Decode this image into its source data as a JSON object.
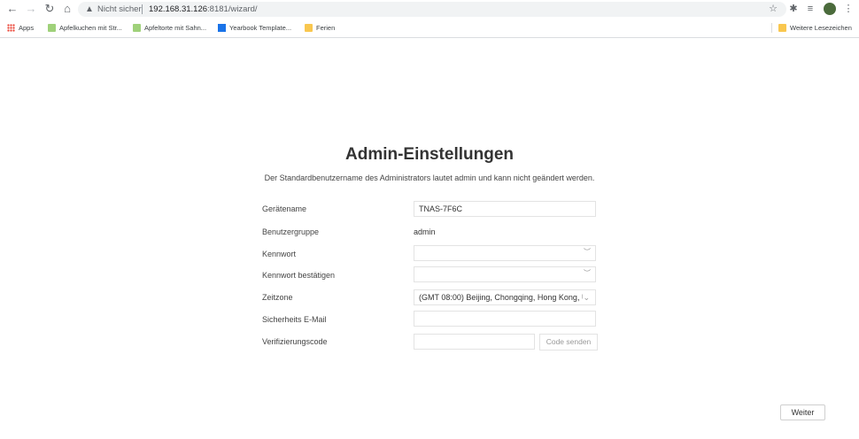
{
  "browser": {
    "security_label": "Nicht sicher",
    "url_host": "192.168.31.126",
    "url_rest": ":8181/wizard/",
    "bookmarks": [
      {
        "label": "Apps"
      },
      {
        "label": "Apfelkuchen mit Str..."
      },
      {
        "label": "Apfeltorte mit Sahn..."
      },
      {
        "label": "Yearbook Template..."
      },
      {
        "label": "Ferien"
      },
      {
        "label": "Weitere Lesezeichen"
      }
    ]
  },
  "wizard": {
    "title": "Admin-Einstellungen",
    "subtitle": "Der Standardbenutzername des Administrators lautet admin und kann nicht geändert werden.",
    "fields": {
      "device_name": {
        "label": "Gerätename",
        "value": "TNAS-7F6C"
      },
      "user_group": {
        "label": "Benutzergruppe",
        "value": "admin"
      },
      "password": {
        "label": "Kennwort",
        "value": ""
      },
      "password_confirm": {
        "label": "Kennwort bestätigen",
        "value": ""
      },
      "timezone": {
        "label": "Zeitzone",
        "value": "(GMT 08:00) Beijing, Chongqing, Hong Kong, U"
      },
      "security_email": {
        "label": "Sicherheits E-Mail",
        "value": ""
      },
      "verification_code": {
        "label": "Verifizierungscode",
        "value": ""
      }
    },
    "send_code_label": "Code senden",
    "next_label": "Weiter"
  }
}
